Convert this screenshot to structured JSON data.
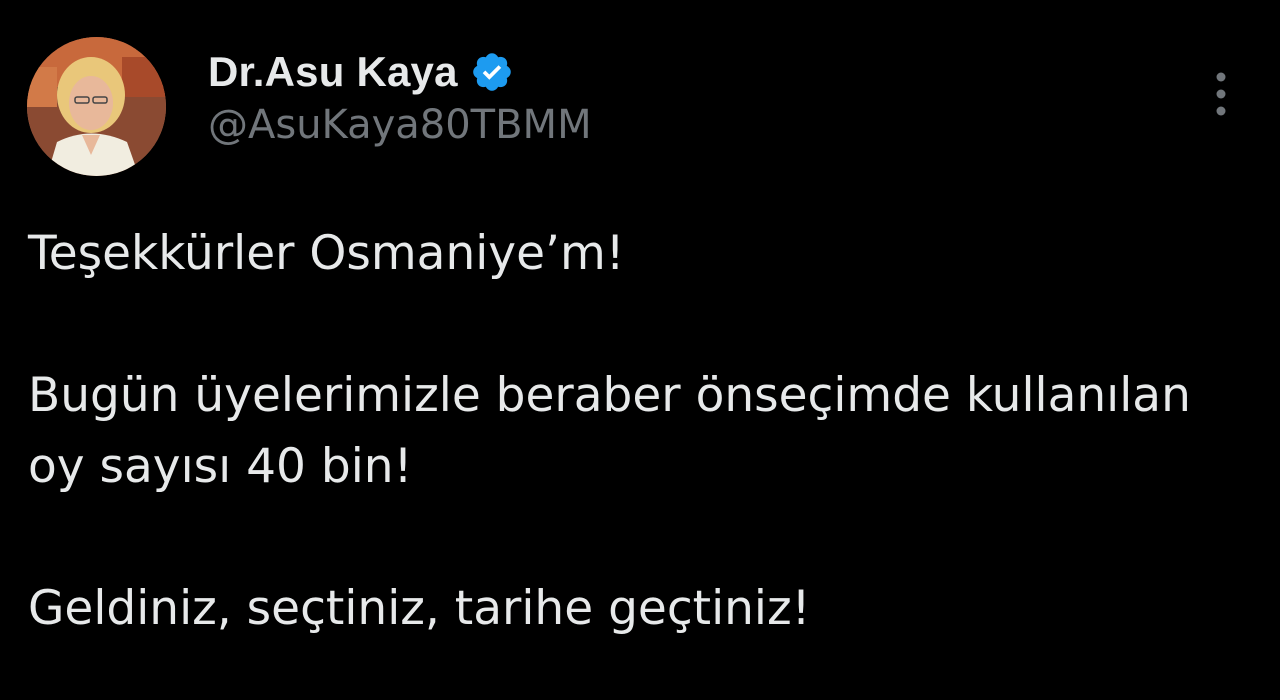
{
  "author": {
    "display_name": "Dr.Asu Kaya",
    "handle": "@AsuKaya80TBMM",
    "verified": true,
    "verified_badge_color": "#1d9bf0"
  },
  "tweet": {
    "paragraphs": [
      "Teşekkürler Osmaniye’m!",
      "Bugün üyelerimizle beraber önseçimde kullanılan oy sayısı 40 bin!",
      "Geldiniz, seçtiniz, tarihe geçtiniz!"
    ]
  },
  "icons": {
    "more": "more-vertical-icon",
    "verified": "verified-badge-icon"
  },
  "theme": {
    "background": "#000000",
    "text": "#e7e9ea",
    "secondary_text": "#71767b"
  }
}
